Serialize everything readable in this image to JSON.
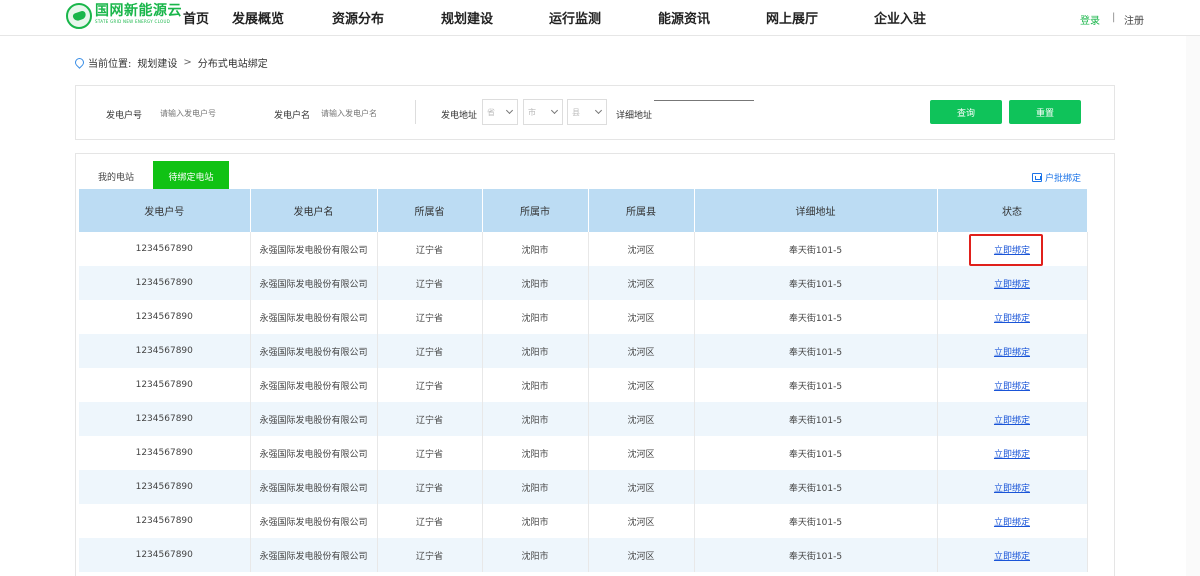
{
  "header": {
    "logo_text": "国网新能源云",
    "logo_subtext": "STATE GRID NEW ENERGY CLOUD",
    "nav": [
      "首页",
      "发展概览",
      "资源分布",
      "规划建设",
      "运行监测",
      "能源资讯",
      "网上展厅",
      "企业入驻"
    ],
    "login": "登录",
    "separator": "|",
    "register": "注册"
  },
  "breadcrumb": {
    "prefix": "当前位置:",
    "parent": "规划建设",
    "separator": ">",
    "current": "分布式电站绑定"
  },
  "filters": {
    "account_no_label": "发电户号",
    "account_no_placeholder": "请输入发电户号",
    "account_name_label": "发电户名",
    "account_name_placeholder": "请输入发电户名",
    "address_label": "发电地址",
    "province_value": "省",
    "city_value": "市",
    "district_value": "县",
    "detail_address_label": "详细地址",
    "query_button": "查询",
    "reset_button": "重置"
  },
  "tabs": {
    "inactive": "我的电站",
    "active": "待绑定电站"
  },
  "bind_link": "户批绑定",
  "table": {
    "headers": [
      "发电户号",
      "发电户名",
      "所属省",
      "所属市",
      "所属县",
      "详细地址",
      "状态"
    ],
    "rows": [
      [
        "1234567890",
        "永强国际发电股份有限公司",
        "辽宁省",
        "沈阳市",
        "沈河区",
        "奉天街101-5",
        "立即绑定"
      ],
      [
        "1234567890",
        "永强国际发电股份有限公司",
        "辽宁省",
        "沈阳市",
        "沈河区",
        "奉天街101-5",
        "立即绑定"
      ],
      [
        "1234567890",
        "永强国际发电股份有限公司",
        "辽宁省",
        "沈阳市",
        "沈河区",
        "奉天街101-5",
        "立即绑定"
      ],
      [
        "1234567890",
        "永强国际发电股份有限公司",
        "辽宁省",
        "沈阳市",
        "沈河区",
        "奉天街101-5",
        "立即绑定"
      ],
      [
        "1234567890",
        "永强国际发电股份有限公司",
        "辽宁省",
        "沈阳市",
        "沈河区",
        "奉天街101-5",
        "立即绑定"
      ],
      [
        "1234567890",
        "永强国际发电股份有限公司",
        "辽宁省",
        "沈阳市",
        "沈河区",
        "奉天街101-5",
        "立即绑定"
      ],
      [
        "1234567890",
        "永强国际发电股份有限公司",
        "辽宁省",
        "沈阳市",
        "沈河区",
        "奉天街101-5",
        "立即绑定"
      ],
      [
        "1234567890",
        "永强国际发电股份有限公司",
        "辽宁省",
        "沈阳市",
        "沈河区",
        "奉天街101-5",
        "立即绑定"
      ],
      [
        "1234567890",
        "永强国际发电股份有限公司",
        "辽宁省",
        "沈阳市",
        "沈河区",
        "奉天街101-5",
        "立即绑定"
      ],
      [
        "1234567890",
        "永强国际发电股份有限公司",
        "辽宁省",
        "沈阳市",
        "沈河区",
        "奉天街101-5",
        "立即绑定"
      ]
    ]
  },
  "colors": {
    "brand_green": "#19b64a",
    "button_green": "#0fc35a",
    "tab_green": "#10c214",
    "header_blue": "#bcdcf3",
    "link_blue": "#1a55d8",
    "highlight_red": "#e0201b"
  }
}
